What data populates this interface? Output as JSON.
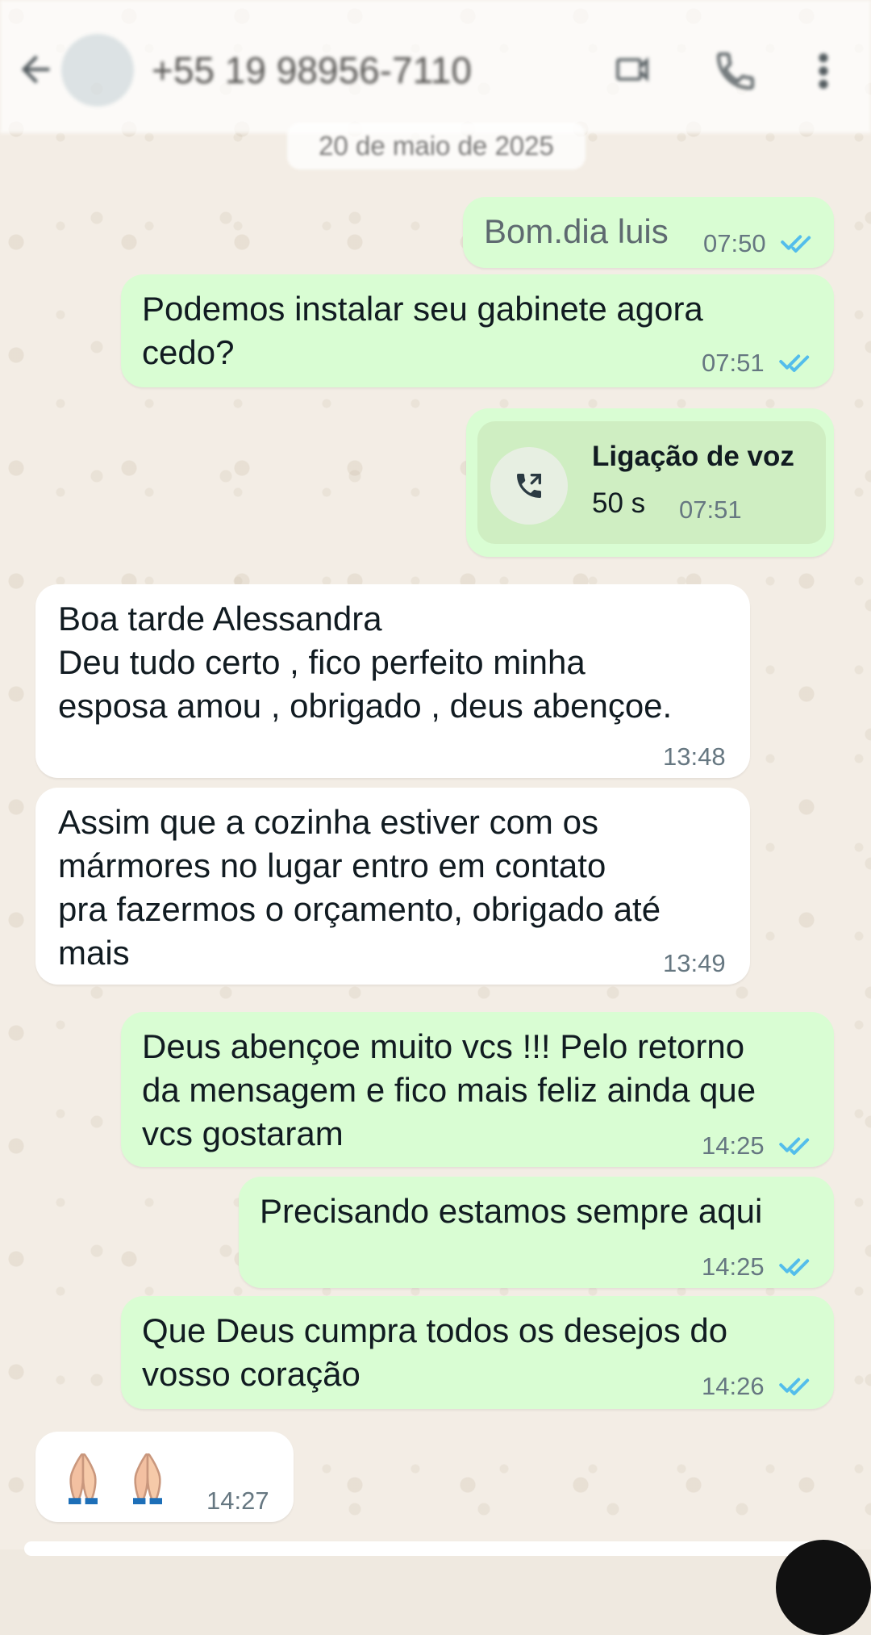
{
  "header": {
    "contact_name": "+55 19 98956-7110",
    "date_label": "20 de maio de 2025"
  },
  "messages": [
    {
      "type": "out",
      "text": "Bom.dia luis",
      "time": "07:50"
    },
    {
      "type": "out",
      "text": "Podemos instalar seu gabinete agora\ncedo?",
      "time": "07:51"
    },
    {
      "type": "out-call",
      "title": "Ligação de voz",
      "duration": "50 s",
      "time": "07:51"
    },
    {
      "type": "in",
      "text": "Boa tarde Alessandra\nDeu tudo certo , fico perfeito minha\nesposa amou , obrigado , deus abençoe.",
      "time": "13:48"
    },
    {
      "type": "in",
      "text": "Assim que a cozinha estiver com os\nmármores no lugar entro em contato\npra fazermos o orçamento, obrigado até\nmais",
      "time": "13:49"
    },
    {
      "type": "out",
      "text": "Deus abençoe muito  vcs !!! Pelo retorno\nda mensagem e fico mais feliz ainda que\nvcs gostaram",
      "time": "14:25"
    },
    {
      "type": "out",
      "text": "Precisando estamos sempre aqui",
      "time": "14:25"
    },
    {
      "type": "out",
      "text": "Que Deus cumpra todos os desejos do\nvosso coração",
      "time": "14:26"
    },
    {
      "type": "in-emoji",
      "emoji": "🙏🏻 🙏🏻",
      "time": "14:27"
    }
  ],
  "icons": {
    "back": "back-arrow-icon",
    "video": "video-call-icon",
    "call": "phone-icon",
    "menu": "more-options-icon",
    "read": "double-check-icon",
    "voice_call": "phone-call-icon",
    "emoji": "pray-icon"
  },
  "colors": {
    "outgoing_bubble": "#d9fdd3",
    "incoming_bubble": "#ffffff",
    "read_ticks": "#53bdeb"
  }
}
